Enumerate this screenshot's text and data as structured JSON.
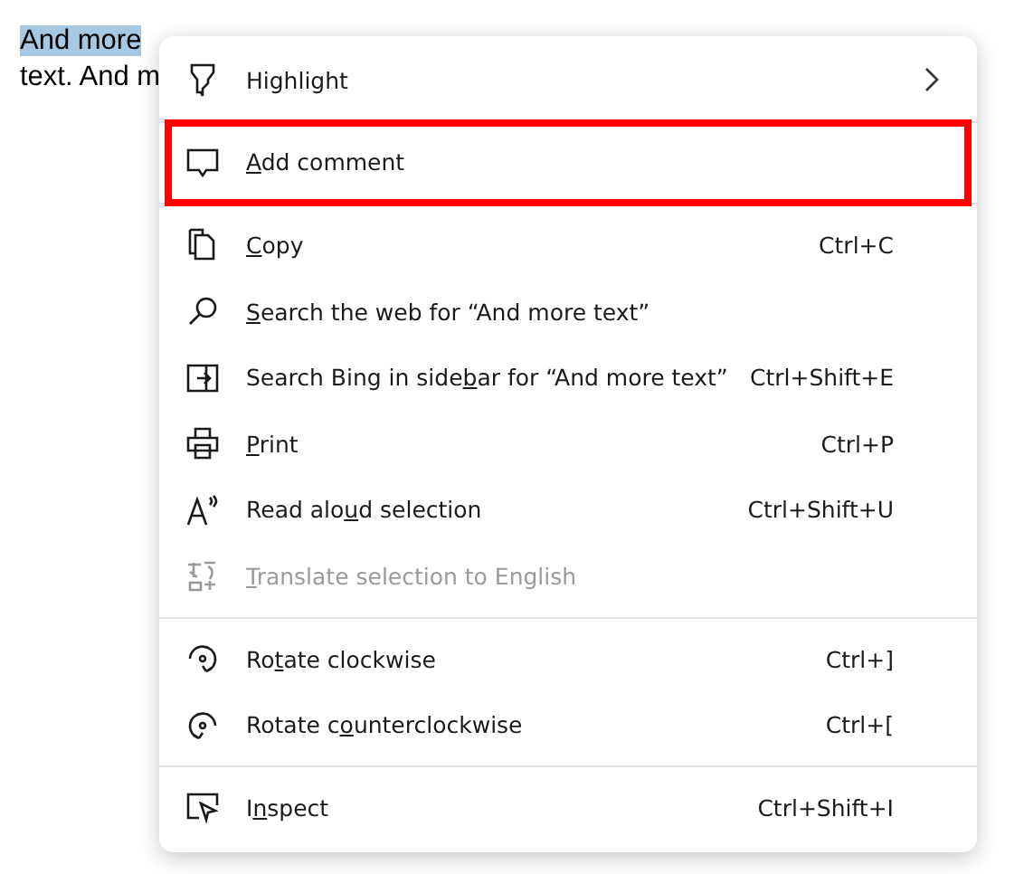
{
  "document": {
    "selected_text": "And more",
    "line_2": "text. And m"
  },
  "menu": {
    "groups": [
      {
        "items": [
          {
            "kind": "highlight",
            "label_before": "Highlight",
            "submenu": true,
            "disabled": false,
            "marked": false
          }
        ]
      },
      {
        "items": [
          {
            "kind": "comment",
            "access_key": "A",
            "label_after": "dd comment",
            "submenu": false,
            "disabled": false,
            "marked": true
          }
        ]
      },
      {
        "items": [
          {
            "kind": "copy",
            "access_key": "C",
            "label_after": "opy",
            "shortcut": "Ctrl+C",
            "submenu": false,
            "disabled": false,
            "marked": false
          },
          {
            "kind": "search",
            "access_key": "S",
            "label_after": "earch the web for “And more text”",
            "submenu": false,
            "disabled": false,
            "marked": false
          },
          {
            "kind": "sidebar",
            "label_before": "Search Bing in side",
            "access_key": "b",
            "label_after": "ar for “And more text”",
            "shortcut": "Ctrl+Shift+E",
            "submenu": false,
            "disabled": false,
            "marked": false
          },
          {
            "kind": "print",
            "access_key": "P",
            "label_after": "rint",
            "shortcut": "Ctrl+P",
            "submenu": false,
            "disabled": false,
            "marked": false
          },
          {
            "kind": "read",
            "label_before": "Read alo",
            "access_key": "u",
            "label_after": "d selection",
            "shortcut": "Ctrl+Shift+U",
            "submenu": false,
            "disabled": false,
            "marked": false
          },
          {
            "kind": "translate",
            "access_key": "T",
            "label_after": "ranslate selection to English",
            "submenu": false,
            "disabled": true,
            "marked": false
          }
        ]
      },
      {
        "items": [
          {
            "kind": "rotate_cw",
            "label_before": "Ro",
            "access_key": "t",
            "label_after": "ate clockwise",
            "shortcut": "Ctrl+]",
            "submenu": false,
            "disabled": false,
            "marked": false
          },
          {
            "kind": "rotate_ccw",
            "label_before": "Rotate c",
            "access_key": "o",
            "label_after": "unterclockwise",
            "shortcut": "Ctrl+[",
            "submenu": false,
            "disabled": false,
            "marked": false
          }
        ]
      },
      {
        "items": [
          {
            "kind": "inspect",
            "label_before": "I",
            "access_key": "n",
            "label_after": "spect",
            "shortcut": "Ctrl+Shift+I",
            "submenu": false,
            "disabled": false,
            "marked": false
          }
        ]
      }
    ]
  }
}
